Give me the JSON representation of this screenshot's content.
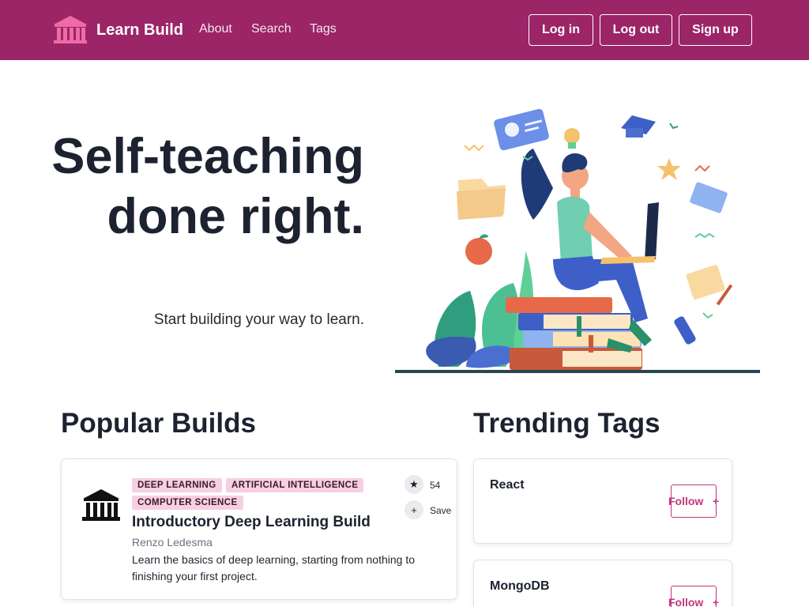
{
  "nav": {
    "brand": "Learn Build",
    "links": [
      "About",
      "Search",
      "Tags"
    ],
    "buttons": {
      "login": "Log in",
      "logout": "Log out",
      "signup": "Sign up"
    }
  },
  "hero": {
    "title": "Self-teaching done right.",
    "subtitle": "Start building your way to learn."
  },
  "popular": {
    "heading": "Popular Builds",
    "builds": [
      {
        "tags": [
          "DEEP LEARNING",
          "ARTIFICIAL INTELLIGENCE",
          "COMPUTER SCIENCE"
        ],
        "title": "Introductory Deep Learning Build",
        "author": "Renzo Ledesma",
        "description": "Learn the basics of deep learning, starting from nothing to finishing your first project.",
        "stars": "54",
        "save_label": "Save",
        "star_icon": "star-icon",
        "save_icon": "plus-icon"
      }
    ]
  },
  "trending": {
    "heading": "Trending Tags",
    "tags": [
      {
        "name": "React",
        "follow_label": "Follow",
        "plus": "+"
      },
      {
        "name": "MongoDB",
        "follow_label": "Follow",
        "plus": "+"
      }
    ]
  },
  "colors": {
    "navbar": "#9b2567",
    "accent": "#c2357f",
    "tag_chip": "#f7cfe0",
    "logo_pink": "#f06ba6"
  }
}
